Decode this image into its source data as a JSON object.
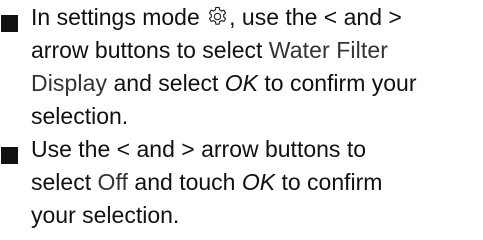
{
  "items": [
    {
      "lines": [
        {
          "segments": [
            {
              "text": "In settings mode "
            },
            {
              "icon": "gear-icon"
            },
            {
              "text": ", use the "
            },
            {
              "text": "<",
              "style": "arrow"
            },
            {
              "text": " and "
            },
            {
              "text": ">",
              "style": "arrow"
            }
          ]
        },
        {
          "segments": [
            {
              "text": "arrow buttons to select "
            },
            {
              "text": "Water Filter",
              "style": "thin"
            }
          ]
        },
        {
          "segments": [
            {
              "text": "Display",
              "style": "thin"
            },
            {
              "text": " and select "
            },
            {
              "text": "OK",
              "style": "em"
            },
            {
              "text": " to confirm your"
            }
          ]
        },
        {
          "segments": [
            {
              "text": "selection."
            }
          ]
        }
      ]
    },
    {
      "lines": [
        {
          "segments": [
            {
              "text": "Use the "
            },
            {
              "text": "<",
              "style": "arrow"
            },
            {
              "text": " and "
            },
            {
              "text": ">",
              "style": "arrow"
            },
            {
              "text": " arrow buttons to"
            }
          ]
        },
        {
          "segments": [
            {
              "text": "select "
            },
            {
              "text": "Off",
              "style": "thin"
            },
            {
              "text": " and touch "
            },
            {
              "text": "OK",
              "style": "em"
            },
            {
              "text": " to confirm"
            }
          ]
        },
        {
          "segments": [
            {
              "text": "your selection."
            }
          ]
        }
      ]
    }
  ]
}
